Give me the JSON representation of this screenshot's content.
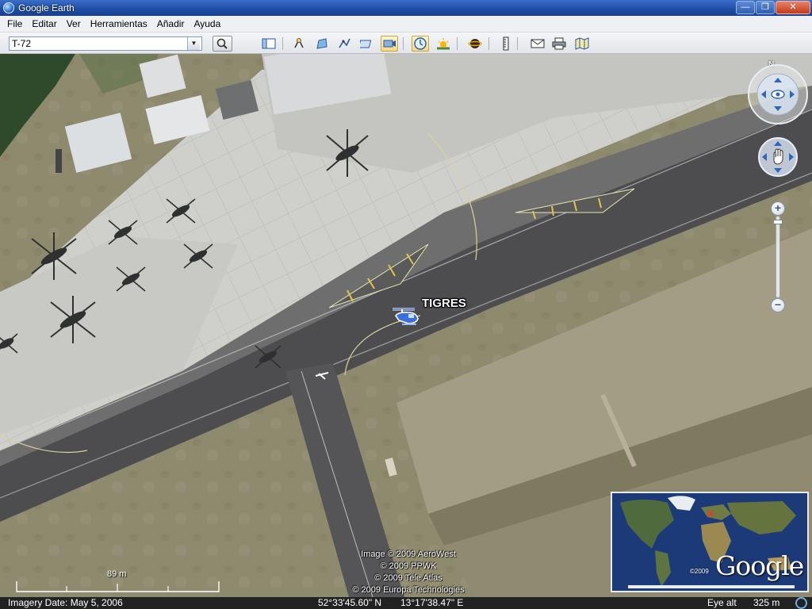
{
  "window": {
    "title": "Google Earth",
    "controls": [
      "—",
      "❐",
      "✕"
    ]
  },
  "menu": [
    "File",
    "Editar",
    "Ver",
    "Herramientas",
    "Añadir",
    "Ayuda"
  ],
  "search": {
    "value": "T-72"
  },
  "toolbar_icons": [
    "sidebar-icon",
    "placemark-icon",
    "polygon-icon",
    "path-icon",
    "image-overlay-icon",
    "record-tour-icon",
    "historical-imagery-icon",
    "sunlight-icon",
    "planets-icon",
    "ruler-icon",
    "email-icon",
    "print-icon",
    "google-maps-icon"
  ],
  "map": {
    "placemark_label": "TIGRES",
    "north_label": "N"
  },
  "credits": [
    "Image © 2009 AeroWest",
    "© 2009 PPWK",
    "© 2009 Tele Atlas",
    "© 2009 Europa Technologies"
  ],
  "overview": {
    "copyright": "©2009",
    "logo": "Google"
  },
  "scale": {
    "label": "89 m"
  },
  "status": {
    "imagery_date": "Imagery Date: May  5, 2006",
    "latitude": "52°33'45.60\" N",
    "longitude": "13°17'38.47\" E",
    "eye_alt_label": "Eye alt",
    "eye_alt_value": "325 m"
  },
  "zoom": {
    "level": 0.95
  },
  "colors": {
    "titlebar": "#1f4fa8",
    "placemark": "#3b6fe0",
    "runway": "#4d4d4f",
    "apron": "#c9c9c5"
  }
}
